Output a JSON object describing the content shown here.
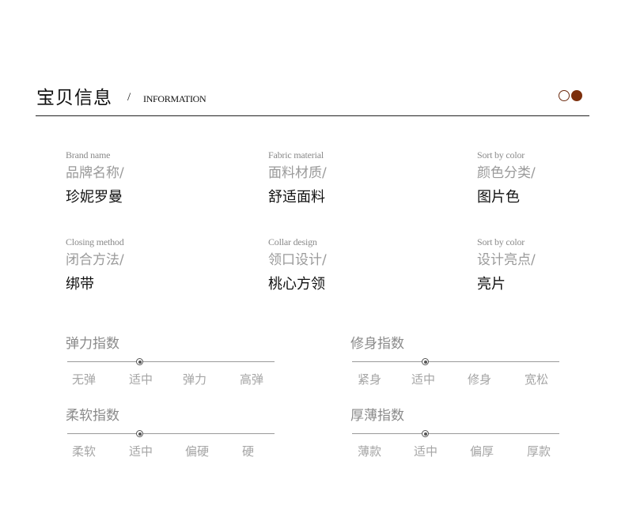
{
  "header": {
    "title": "宝贝信息",
    "slash": "/",
    "subtitle": "INFORMATION",
    "accent_color": "#7c2f0c"
  },
  "info": [
    {
      "en": "Brand name",
      "cn": "品牌名称/",
      "value": "珍妮罗曼"
    },
    {
      "en": "Fabric material",
      "cn": "面料材质/",
      "value": "舒适面料"
    },
    {
      "en": "Sort by color",
      "cn": "颜色分类/",
      "value": "图片色"
    },
    {
      "en": "Closing method",
      "cn": "闭合方法/",
      "value": "绑带"
    },
    {
      "en": "Collar design",
      "cn": "领口设计/",
      "value": "桃心方领"
    },
    {
      "en": "Sort by color",
      "cn": "设计亮点/",
      "value": "亮片"
    }
  ],
  "scales": [
    {
      "title": "弹力指数",
      "labels": [
        "无弹",
        "适中",
        "弹力",
        "高弹"
      ],
      "selected_index": 1
    },
    {
      "title": "修身指数",
      "labels": [
        "紧身",
        "适中",
        "修身",
        "宽松"
      ],
      "selected_index": 1
    },
    {
      "title": "柔软指数",
      "labels": [
        "柔软",
        "适中",
        "偏硬",
        "硬"
      ],
      "selected_index": 1
    },
    {
      "title": "厚薄指数",
      "labels": [
        "薄款",
        "适中",
        "偏厚",
        "厚款"
      ],
      "selected_index": 1
    }
  ]
}
